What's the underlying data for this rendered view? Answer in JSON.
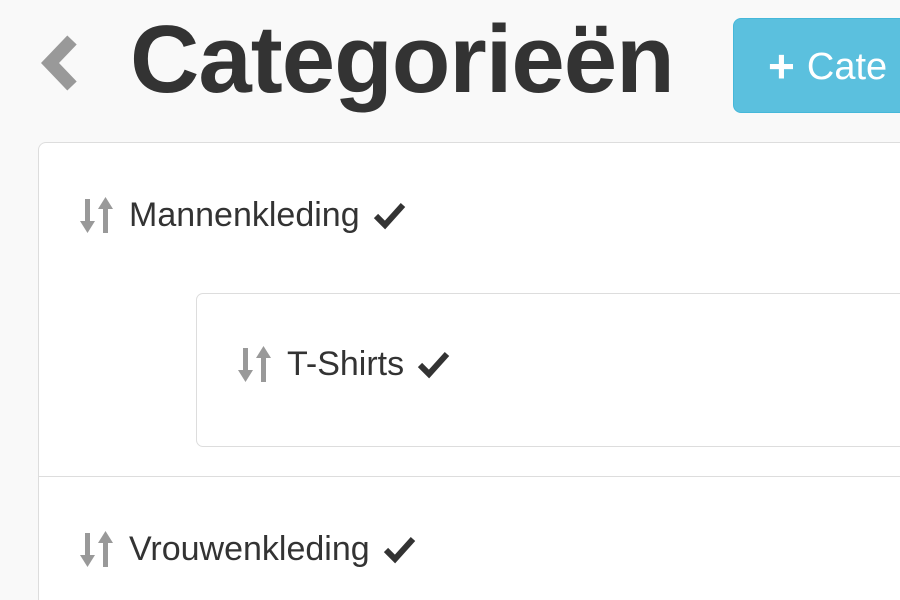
{
  "header": {
    "title": "Categorieën",
    "back_icon": "chevron-left-icon",
    "add_button_label": "Cate",
    "add_button_icon": "plus-icon",
    "add_button_color": "#5bc0de"
  },
  "categories": [
    {
      "label": "Mannenkleding",
      "sort_icon": "sort-arrows-icon",
      "status_icon": "check-icon",
      "children": [
        {
          "label": "T-Shirts",
          "sort_icon": "sort-arrows-icon",
          "status_icon": "check-icon"
        }
      ]
    },
    {
      "label": "Vrouwenkleding",
      "sort_icon": "sort-arrows-icon",
      "status_icon": "check-icon",
      "children": []
    }
  ]
}
